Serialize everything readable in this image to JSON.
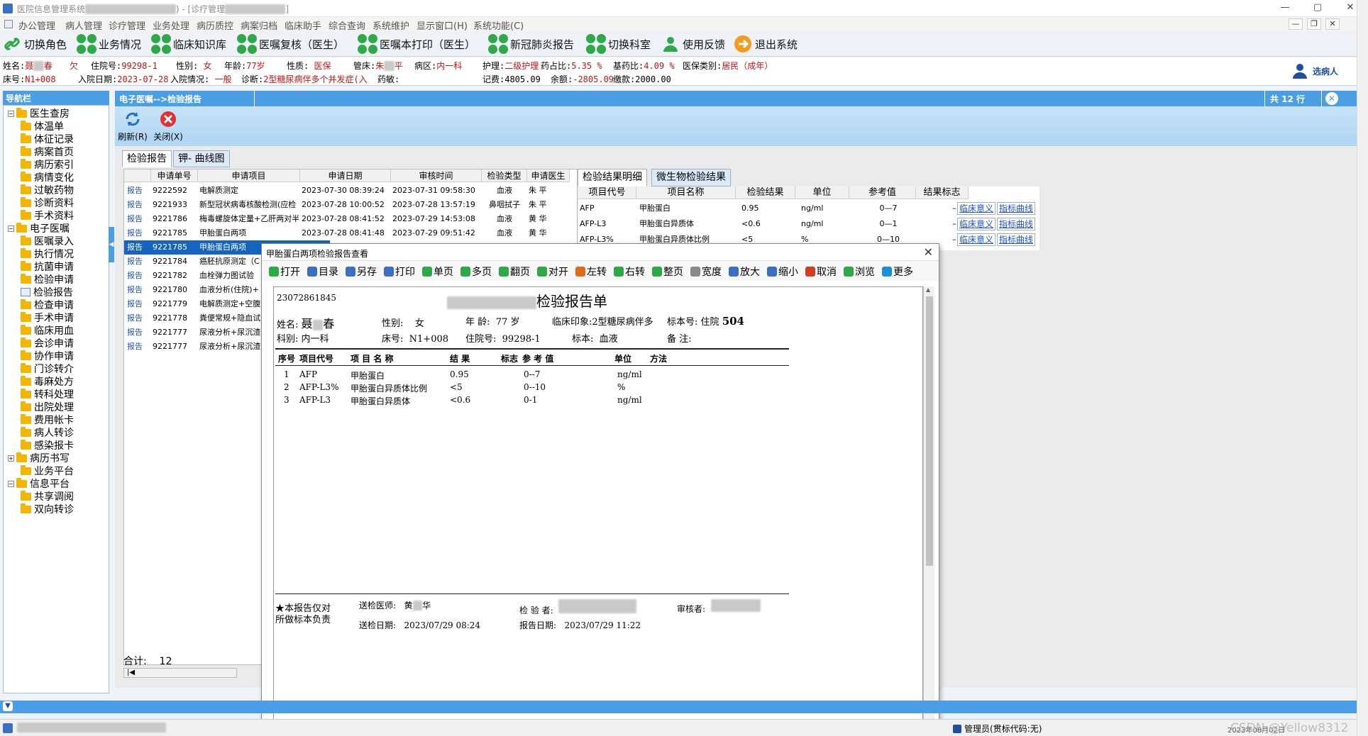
{
  "window": {
    "title_parts": [
      "医院信息管理系统",
      "[诊疗管理",
      "]"
    ],
    "min": "—",
    "max": "▢",
    "close": "✕"
  },
  "menu": [
    "办公管理",
    "病人管理",
    "诊疗管理",
    "业务处理",
    "病历质控",
    "病案归档",
    "临床助手",
    "综合查询",
    "系统维护",
    "显示窗口(H)",
    "系统功能(C)"
  ],
  "toolbar": [
    {
      "label": "切换角色",
      "icon": "link-icon"
    },
    {
      "label": "业务情况",
      "icon": "clover-icon"
    },
    {
      "label": "临床知识库",
      "icon": "clover-icon"
    },
    {
      "label": "医嘱复核（医生）",
      "icon": "clover-icon"
    },
    {
      "label": "医嘱本打印（医生）",
      "icon": "clover-icon"
    },
    {
      "label": "新冠肺炎报告",
      "icon": "clover-icon"
    },
    {
      "label": "切换科室",
      "icon": "clover-icon"
    },
    {
      "label": "使用反馈",
      "icon": "user-icon"
    },
    {
      "label": "退出系统",
      "icon": "exit-icon"
    }
  ],
  "patient": {
    "name_label": "姓名:",
    "name_a": "聂",
    "name_b": "春",
    "owe": "欠",
    "inpatient_no_label": "住院号:",
    "inpatient_no": "99298-1",
    "gender_label": "性别:",
    "gender": "女",
    "age_label": "年龄:",
    "age": "77岁",
    "nature_label": "性质:",
    "nature": "医保",
    "nurse_label": "管床:",
    "nurse_a": "朱",
    "nurse_b": "平",
    "ward_label": "病区:",
    "ward": "内一科",
    "care_label": "护理:",
    "care": "二级护理",
    "drug_ratio_label": "药占比:",
    "drug_ratio": "5.35 %",
    "base_drug_label": "基药比:",
    "base_drug": "4.09 %",
    "insurance_label": "医保类别:",
    "insurance": "居民（成年）",
    "bed_label": "床号:",
    "bed": "N1+008",
    "admit_date_label": "入院日期:",
    "admit_date": "2023-07-28",
    "admit_status_label": "入院情况:",
    "admit_status": "一般",
    "diagnosis_label": "诊断:",
    "diagnosis": "2型糖尿病伴多个并发症(入",
    "allergy_label": "药敏:",
    "allergy": "",
    "fee_label": "记费:",
    "fee": "4805.09",
    "balance_label": "余额:",
    "balance": "-2805.09",
    "paid_label": "缴款:",
    "paid": "2000.00",
    "choose_patient": "选病人"
  },
  "nav": {
    "title": "导航栏",
    "items": [
      {
        "label": "医生查房",
        "level": 0,
        "exp": "−"
      },
      {
        "label": "体温单",
        "level": 1
      },
      {
        "label": "体征记录",
        "level": 1
      },
      {
        "label": "病案首页",
        "level": 1
      },
      {
        "label": "病历索引",
        "level": 1
      },
      {
        "label": "病情变化",
        "level": 1
      },
      {
        "label": "过敏药物",
        "level": 1
      },
      {
        "label": "诊断资料",
        "level": 1
      },
      {
        "label": "手术资料",
        "level": 1
      },
      {
        "label": "电子医嘱",
        "level": 0,
        "exp": "−"
      },
      {
        "label": "医嘱录入",
        "level": 1
      },
      {
        "label": "执行情况",
        "level": 1
      },
      {
        "label": "抗菌申请",
        "level": 1
      },
      {
        "label": "检验申请",
        "level": 1
      },
      {
        "label": "检验报告",
        "level": 1,
        "doc": true
      },
      {
        "label": "检查申请",
        "level": 1
      },
      {
        "label": "手术申请",
        "level": 1
      },
      {
        "label": "临床用血",
        "level": 1
      },
      {
        "label": "会诊申请",
        "level": 1
      },
      {
        "label": "协作申请",
        "level": 1
      },
      {
        "label": "门诊转介",
        "level": 1
      },
      {
        "label": "毒麻处方",
        "level": 1
      },
      {
        "label": "转科处理",
        "level": 1
      },
      {
        "label": "出院处理",
        "level": 1
      },
      {
        "label": "费用帐卡",
        "level": 1
      },
      {
        "label": "病人转诊",
        "level": 1
      },
      {
        "label": "感染报卡",
        "level": 1
      },
      {
        "label": "病历书写",
        "level": 0,
        "exp": "+"
      },
      {
        "label": "业务平台",
        "level": 1
      },
      {
        "label": "信息平台",
        "level": 0,
        "exp": "−"
      },
      {
        "label": "共享调阅",
        "level": 1
      },
      {
        "label": "双向转诊",
        "level": 1
      }
    ],
    "splitter": "◀"
  },
  "content": {
    "title": "电子医嘱-->检验报告",
    "rows_info": "共 12 行",
    "close_icon": "✕",
    "refresh": "刷新(R)",
    "close": "关闭(X)",
    "tabs": [
      "检验报告",
      "钾- 曲线图"
    ],
    "right_tabs": [
      "检验结果明细",
      "微生物检验结果"
    ]
  },
  "grid": {
    "headers": [
      "申请单号",
      "申请项目",
      "申请日期",
      "审核时间",
      "检验类型",
      "申请医生"
    ],
    "rows": [
      {
        "link": "报告",
        "id": "9222592",
        "item": "电解质测定",
        "date": "2023-07-30 08:39:24",
        "audit": "2023-07-31 09:58:30",
        "type": "血液",
        "doc": "朱  平"
      },
      {
        "link": "报告",
        "id": "9221933",
        "item": "新型冠状病毒核酸检测(应检",
        "date": "2023-07-28 10:00:52",
        "audit": "2023-07-28 13:57:19",
        "type": "鼻咽拭子",
        "doc": "朱  平"
      },
      {
        "link": "报告",
        "id": "9221786",
        "item": "梅毒螺旋体定量+乙肝两对半",
        "date": "2023-07-28 08:41:52",
        "audit": "2023-07-29 14:53:08",
        "type": "血液",
        "doc": "黄  华"
      },
      {
        "link": "报告",
        "id": "9221785",
        "item": "甲胎蛋白两项",
        "date": "2023-07-28 08:41:48",
        "audit": "2023-07-29 09:51:42",
        "type": "血液",
        "doc": "黄  华"
      },
      {
        "link": "报告",
        "id": "9221785",
        "item": "甲胎蛋白两项",
        "date": "",
        "audit": "",
        "type": "",
        "doc": "",
        "sel": true
      },
      {
        "link": "报告",
        "id": "9221784",
        "item": "癌胚抗原测定（C",
        "date": "",
        "audit": "",
        "type": "",
        "doc": ""
      },
      {
        "link": "报告",
        "id": "9221782",
        "item": "血栓弹力图试验",
        "date": "",
        "audit": "",
        "type": "",
        "doc": ""
      },
      {
        "link": "报告",
        "id": "9221780",
        "item": "血液分析(住院)+",
        "date": "",
        "audit": "",
        "type": "",
        "doc": ""
      },
      {
        "link": "报告",
        "id": "9221779",
        "item": "电解质测定+空腹",
        "date": "",
        "audit": "",
        "type": "",
        "doc": ""
      },
      {
        "link": "报告",
        "id": "9221778",
        "item": "粪便常规+隐血试",
        "date": "",
        "audit": "",
        "type": "",
        "doc": ""
      },
      {
        "link": "报告",
        "id": "9221777",
        "item": "尿液分析+尿沉渣",
        "date": "",
        "audit": "",
        "type": "",
        "doc": ""
      },
      {
        "link": "报告",
        "id": "9221777",
        "item": "尿液分析+尿沉渣",
        "date": "",
        "audit": "",
        "type": "",
        "doc": ""
      }
    ],
    "total_label": "合计:",
    "total": "12"
  },
  "results": {
    "headers": [
      "项目代号",
      "项目名称",
      "检验结果",
      "单位",
      "参考值",
      "结果标志"
    ],
    "rows": [
      {
        "code": "AFP",
        "name": "甲胎蛋白",
        "value": "0.95",
        "unit": "ng/ml",
        "ref": "0—7",
        "flag": "–",
        "btn1": "临床意义",
        "btn2": "指标曲线"
      },
      {
        "code": "AFP-L3",
        "name": "甲胎蛋白异质体",
        "value": "<0.6",
        "unit": "ng/ml",
        "ref": "0—1",
        "flag": "–",
        "btn1": "临床意义",
        "btn2": "指标曲线"
      },
      {
        "code": "AFP-L3%",
        "name": "甲胎蛋白异质体比例",
        "value": "<5",
        "unit": "%",
        "ref": "0—10",
        "flag": "–",
        "btn1": "临床意义",
        "btn2": "指标曲线"
      }
    ]
  },
  "popup": {
    "title": "甲胎蛋白两项检验报告查看",
    "close": "✕",
    "toolbar": [
      "打开",
      "目录",
      "另存",
      "打印",
      "单页",
      "多页",
      "翻页",
      "对开",
      "左转",
      "右转",
      "整页",
      "宽度",
      "放大",
      "缩小",
      "取消",
      "浏览",
      "更多"
    ],
    "toolbar_colors": [
      "#2fa84a",
      "#3a6fc4",
      "#3a6fc4",
      "#3a6fc4",
      "#2fa84a",
      "#2fa84a",
      "#2fa84a",
      "#2fa84a",
      "#e06a1a",
      "#2fa84a",
      "#2fa84a",
      "#888888",
      "#3a6fc4",
      "#3a6fc4",
      "#d04020",
      "#2fa84a",
      "#1d8fd6"
    ],
    "report": {
      "barcode": "23072861845",
      "title": "检验报告单",
      "name_label": "姓名:",
      "name_a": "聂",
      "name_b": "春",
      "sex_label": "性别:",
      "sex": "女",
      "age_label": "年  龄:",
      "age": "77 岁",
      "impression_label": "临床印象:",
      "impression": "2型糖尿病伴多",
      "specimen_no_label": "标本号:",
      "specimen_no_prefix": "住院",
      "specimen_no": "504",
      "dept_label": "科别:",
      "dept": "内一科",
      "bed_label": "床号:",
      "bed": "N1+008",
      "inpatient_label": "住院号:",
      "inpatient": "99298-1",
      "specimen_label": "标本:",
      "specimen": "血液",
      "remark_label": "备  注:",
      "remark": "",
      "col_headers": [
        "序号",
        "项目代号",
        "项 目 名 称",
        "结  果",
        "标志",
        "参  考  值",
        "单位",
        "方法"
      ],
      "rows": [
        {
          "no": "1",
          "code": "AFP",
          "name": "甲胎蛋白",
          "result": "0.95",
          "flag": "",
          "ref": "0--7",
          "unit": "ng/ml",
          "method": ""
        },
        {
          "no": "2",
          "code": "AFP-L3%",
          "name": "甲胎蛋白异质体比例",
          "result": "<5",
          "flag": "",
          "ref": "0--10",
          "unit": "%",
          "method": ""
        },
        {
          "no": "3",
          "code": "AFP-L3",
          "name": "甲胎蛋白异质体",
          "result": "<0.6",
          "flag": "",
          "ref": "0-1",
          "unit": "ng/ml",
          "method": ""
        }
      ],
      "footnote_1": "★本报告仅对",
      "footnote_2": "所做标本负责",
      "sender_label": "送检医师:",
      "sender_a": "黄",
      "sender_b": "华",
      "inspector_label": "检 验 者:",
      "reviewer_label": "审核者:",
      "send_date_label": "送检日期:",
      "send_date": "2023/07/29 08:24",
      "report_date_label": "报告日期:",
      "report_date": "2023/07/29 11:22"
    }
  },
  "status": {
    "user": "管理员(贯标代码:无)",
    "date": "2023年08月02日",
    "watermark": "CSDN @Yellow8312"
  }
}
